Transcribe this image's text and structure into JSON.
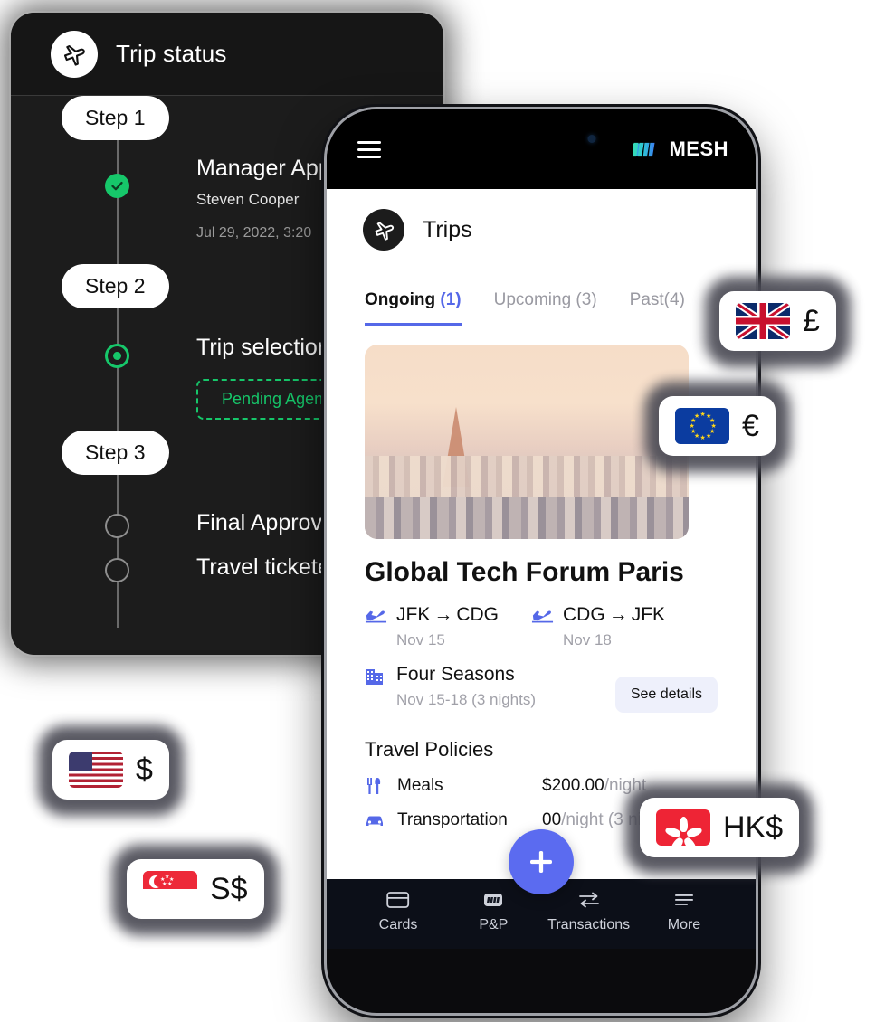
{
  "trip_status": {
    "header_title": "Trip status",
    "header_icon": "airplane-icon",
    "steps": [
      {
        "pill": "Step 1",
        "node_state": "done",
        "title": "Manager App",
        "subtitle": "Steven Cooper",
        "date": "Jul 29, 2022, 3:20"
      },
      {
        "pill": "Step 2",
        "node_state": "current",
        "title": "Trip selection",
        "chip": "Pending Agent"
      },
      {
        "pill": "Step 3",
        "node_state": "todo",
        "title": "Final Approva",
        "title2": "Travel tickete"
      }
    ],
    "colors": {
      "accent_green": "#16c76a",
      "card_bg": "#1c1c1c"
    }
  },
  "phone": {
    "statusbar": {
      "menu_icon": "hamburger-icon",
      "brand": "MESH",
      "brand_mark": "mesh-logo-icon"
    },
    "app_header": {
      "icon": "airplane-icon",
      "title": "Trips"
    },
    "tabs": [
      {
        "label": "Ongoing",
        "count": "(1)",
        "active": true
      },
      {
        "label": "Upcoming (3)",
        "count": "",
        "active": false
      },
      {
        "label": "Past(4)",
        "count": "",
        "active": false
      }
    ],
    "trip": {
      "photo_alt": "paris-skyline-photo",
      "name": "Global Tech Forum Paris",
      "legs": [
        {
          "icon": "flight-takeoff-icon",
          "from": "JFK",
          "arrow": "→",
          "to": "CDG",
          "date": "Nov 15"
        },
        {
          "icon": "flight-takeoff-icon",
          "from": "CDG",
          "arrow": "→",
          "to": "JFK",
          "date": "Nov 18"
        }
      ],
      "hotel": {
        "icon": "hotel-icon",
        "name": "Four Seasons",
        "dates": "Nov 15-18 (3 nights)"
      },
      "see_details": "See details"
    },
    "policies": {
      "title": "Travel Policies",
      "rows": [
        {
          "icon": "meals-icon",
          "label": "Meals",
          "value": "$200.00",
          "unit": "/night"
        },
        {
          "icon": "car-icon",
          "label": "Transportation",
          "value": "00",
          "unit": "/night (3 nights)"
        }
      ]
    },
    "fab": {
      "icon": "plus-icon",
      "label": "+"
    },
    "bottom_nav": [
      {
        "icon": "card-icon",
        "label": "Cards"
      },
      {
        "icon": "mesh-square-icon",
        "label": "P&P"
      },
      {
        "icon": "transfer-icon",
        "label": "Transactions"
      },
      {
        "icon": "more-icon",
        "label": "More"
      }
    ],
    "accent_blue": "#5568e8",
    "fab_color": "#5b6bf0"
  },
  "currency_badges": [
    {
      "id": "gbp",
      "flag": "uk-flag-icon",
      "symbol": "£"
    },
    {
      "id": "eur",
      "flag": "eu-flag-icon",
      "symbol": "€"
    },
    {
      "id": "usd",
      "flag": "us-flag-icon",
      "symbol": "$"
    },
    {
      "id": "sgd",
      "flag": "sg-flag-icon",
      "symbol": "S$"
    },
    {
      "id": "hkd",
      "flag": "hk-flag-icon",
      "symbol": "HK$"
    }
  ]
}
